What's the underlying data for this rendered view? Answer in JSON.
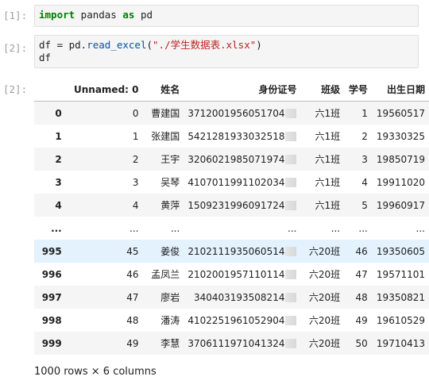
{
  "cell1": {
    "prompt": "[1]:",
    "code": {
      "kw1": "import",
      "mid": " pandas ",
      "kw2": "as",
      "end": " pd"
    }
  },
  "cell2": {
    "prompt": "[2]:",
    "line1": {
      "pre": "df = pd.",
      "fn": "read_excel",
      "open": "(",
      "str": "\"./学生数据表.xlsx\"",
      "close": ")"
    },
    "line2": "df"
  },
  "output": {
    "prompt": "[2]:",
    "columns": [
      "",
      "Unnamed: 0",
      "姓名",
      "身份证号",
      "班级",
      "学号",
      "出生日期"
    ],
    "rows": [
      [
        "0",
        "0",
        "曹建国",
        "3712001956051704",
        "六1班",
        "1",
        "19560517"
      ],
      [
        "1",
        "1",
        "张建国",
        "5421281933032518",
        "六1班",
        "2",
        "19330325"
      ],
      [
        "2",
        "2",
        "王宇",
        "3206021985071974",
        "六1班",
        "3",
        "19850719"
      ],
      [
        "3",
        "3",
        "吴琴",
        "4107011991102034",
        "六1班",
        "4",
        "19911020"
      ],
      [
        "4",
        "4",
        "黄萍",
        "1509231996091724",
        "六1班",
        "5",
        "19960917"
      ],
      [
        "...",
        "...",
        "...",
        "...",
        "...",
        "...",
        "..."
      ],
      [
        "995",
        "45",
        "姜俊",
        "2102111935060514",
        "六20班",
        "46",
        "19350605"
      ],
      [
        "996",
        "46",
        "孟凤兰",
        "2102001957110114",
        "六20班",
        "47",
        "19571101"
      ],
      [
        "997",
        "47",
        "廖岩",
        "340403193508214",
        "六20班",
        "48",
        "19350821"
      ],
      [
        "998",
        "48",
        "潘涛",
        "4102251961052904",
        "六20班",
        "49",
        "19610529"
      ],
      [
        "999",
        "49",
        "李慧",
        "3706111971041324",
        "六20班",
        "50",
        "19710413"
      ]
    ],
    "highlight_row": 6,
    "footer": "1000 rows × 6 columns"
  }
}
